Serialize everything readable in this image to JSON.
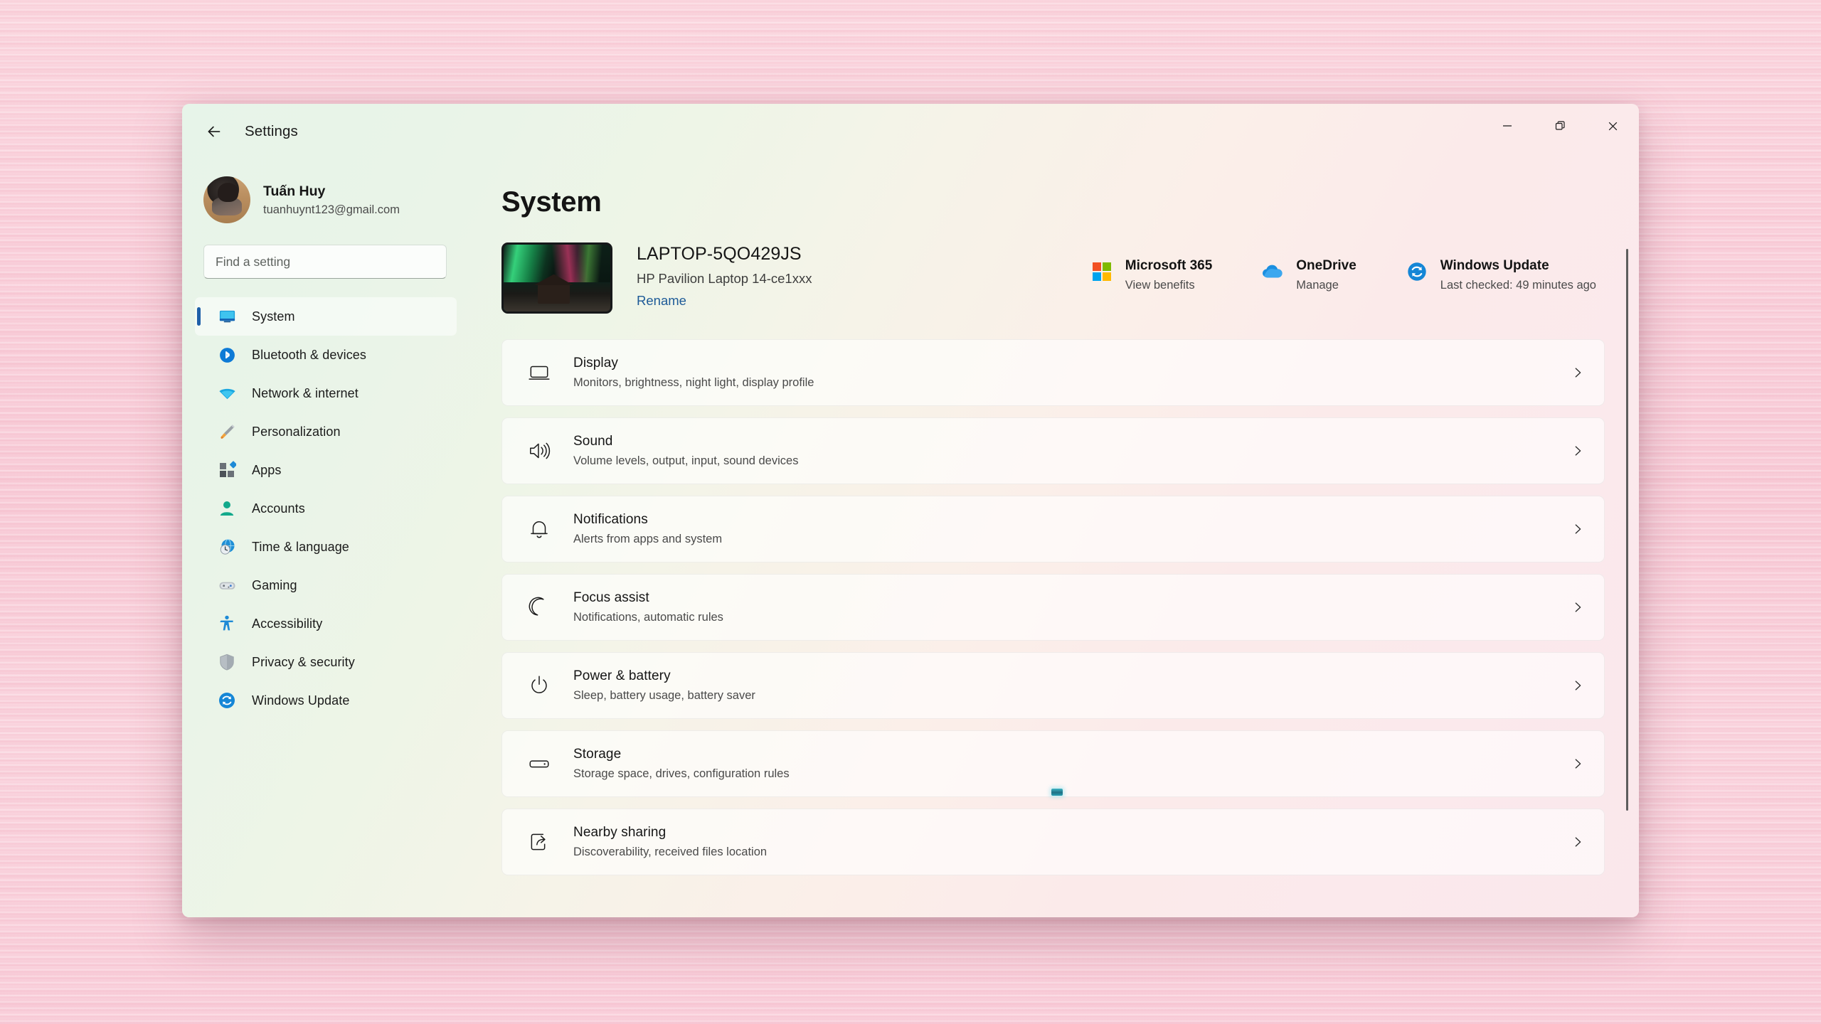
{
  "window": {
    "title": "Settings",
    "back_icon": "back-arrow-icon",
    "controls": {
      "minimize": "minimize-icon",
      "restore": "restore-icon",
      "close": "close-icon"
    }
  },
  "account": {
    "name": "Tuấn Huy",
    "email": "tuanhuynt123@gmail.com"
  },
  "search": {
    "placeholder": "Find a setting",
    "value": "",
    "icon": "search-icon"
  },
  "sidebar": {
    "items": [
      {
        "label": "System",
        "icon": "monitor-icon",
        "selected": true
      },
      {
        "label": "Bluetooth & devices",
        "icon": "bluetooth-icon",
        "selected": false
      },
      {
        "label": "Network & internet",
        "icon": "wifi-icon",
        "selected": false
      },
      {
        "label": "Personalization",
        "icon": "paintbrush-icon",
        "selected": false
      },
      {
        "label": "Apps",
        "icon": "apps-grid-icon",
        "selected": false
      },
      {
        "label": "Accounts",
        "icon": "person-icon",
        "selected": false
      },
      {
        "label": "Time & language",
        "icon": "clock-globe-icon",
        "selected": false
      },
      {
        "label": "Gaming",
        "icon": "gamepad-icon",
        "selected": false
      },
      {
        "label": "Accessibility",
        "icon": "accessibility-icon",
        "selected": false
      },
      {
        "label": "Privacy & security",
        "icon": "shield-icon",
        "selected": false
      },
      {
        "label": "Windows Update",
        "icon": "update-refresh-icon",
        "selected": false
      }
    ]
  },
  "main": {
    "page_title": "System",
    "device": {
      "name": "LAPTOP-5QO429JS",
      "model": "HP Pavilion Laptop 14-ce1xxx",
      "rename_label": "Rename",
      "thumbnail": "aurora-wallpaper-thumbnail"
    },
    "quick_links": [
      {
        "title": "Microsoft 365",
        "subtitle": "View benefits",
        "icon": "microsoft-logo-icon"
      },
      {
        "title": "OneDrive",
        "subtitle": "Manage",
        "icon": "onedrive-cloud-icon"
      },
      {
        "title": "Windows Update",
        "subtitle": "Last checked: 49 minutes ago",
        "icon": "update-refresh-icon"
      }
    ],
    "cards": [
      {
        "title": "Display",
        "subtitle": "Monitors, brightness, night light, display profile",
        "icon": "monitor-outline-icon"
      },
      {
        "title": "Sound",
        "subtitle": "Volume levels, output, input, sound devices",
        "icon": "speaker-icon"
      },
      {
        "title": "Notifications",
        "subtitle": "Alerts from apps and system",
        "icon": "bell-icon"
      },
      {
        "title": "Focus assist",
        "subtitle": "Notifications, automatic rules",
        "icon": "moon-icon"
      },
      {
        "title": "Power & battery",
        "subtitle": "Sleep, battery usage, battery saver",
        "icon": "power-icon"
      },
      {
        "title": "Storage",
        "subtitle": "Storage space, drives, configuration rules",
        "icon": "drive-icon"
      },
      {
        "title": "Nearby sharing",
        "subtitle": "Discoverability, received files location",
        "icon": "share-icon"
      }
    ],
    "chevron_icon": "chevron-right-icon"
  },
  "colors": {
    "accent_blue": "#1e5fa8",
    "link_blue": "#1d5a97",
    "bluetooth_blue": "#0d7ad6",
    "update_blue": "#1586d6",
    "accounts_teal": "#1aa38a",
    "accessibility_blue": "#1e8ad6"
  }
}
